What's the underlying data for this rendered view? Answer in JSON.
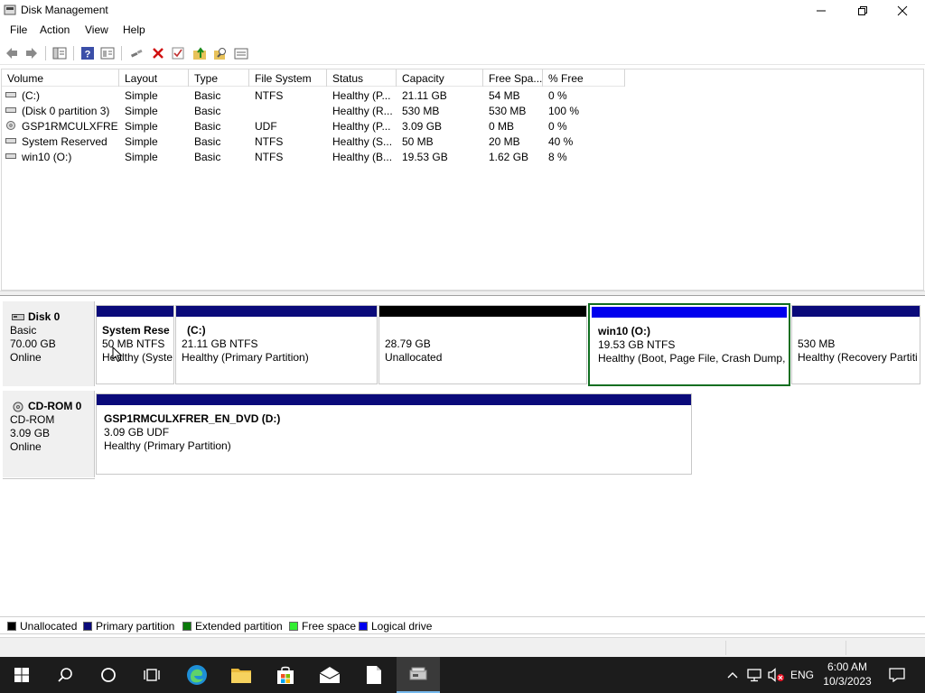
{
  "window": {
    "title": "Disk Management"
  },
  "menu": [
    "File",
    "Action",
    "View",
    "Help"
  ],
  "toolbar_icons": [
    "back-arrow-icon",
    "forward-arrow-icon",
    "console-tree-icon",
    "help-icon",
    "properties-icon",
    "connect-icon",
    "delete-icon",
    "check-icon",
    "folder-up-icon",
    "search-icon",
    "list-icon"
  ],
  "volume_list": {
    "columns": [
      "Volume",
      "Layout",
      "Type",
      "File System",
      "Status",
      "Capacity",
      "Free Spa...",
      "% Free"
    ],
    "rows": [
      [
        "(C:)",
        "Simple",
        "Basic",
        "NTFS",
        "Healthy (P...",
        "21.11 GB",
        "54 MB",
        "0 %"
      ],
      [
        "(Disk 0 partition 3)",
        "Simple",
        "Basic",
        "",
        "Healthy (R...",
        "530 MB",
        "530 MB",
        "100 %"
      ],
      [
        "GSP1RMCULXFRE...",
        "Simple",
        "Basic",
        "UDF",
        "Healthy (P...",
        "3.09 GB",
        "0 MB",
        "0 %"
      ],
      [
        "System Reserved",
        "Simple",
        "Basic",
        "NTFS",
        "Healthy (S...",
        "50 MB",
        "20 MB",
        "40 %"
      ],
      [
        "win10 (O:)",
        "Simple",
        "Basic",
        "NTFS",
        "Healthy (B...",
        "19.53 GB",
        "1.62 GB",
        "8 %"
      ]
    ]
  },
  "disks": [
    {
      "name": "Disk 0",
      "type": "Basic",
      "size": "70.00 GB",
      "state": "Online",
      "partitions": [
        {
          "name": "System Rese",
          "size": "50 MB NTFS",
          "status": "Healthy (Syste",
          "bar": "#0a0a7a"
        },
        {
          "name": "(C:)",
          "size": "21.11 GB NTFS",
          "status": "Healthy (Primary Partition)",
          "bar": "#0a0a7a"
        },
        {
          "name": "",
          "size": "28.79 GB",
          "status": "Unallocated",
          "bar": "#000000"
        },
        {
          "name": "win10  (O:)",
          "size": "19.53 GB NTFS",
          "status": "Healthy (Boot, Page File, Crash Dump,",
          "bar": "#0000ee"
        },
        {
          "name": "",
          "size": "530 MB",
          "status": "Healthy (Recovery Partiti",
          "bar": "#0a0a7a"
        }
      ]
    },
    {
      "name": "CD-ROM 0",
      "type": "CD-ROM",
      "size": "3.09 GB",
      "state": "Online",
      "partitions": [
        {
          "name": "GSP1RMCULXFRER_EN_DVD  (D:)",
          "size": "3.09 GB UDF",
          "status": "Healthy (Primary Partition)",
          "bar": "#0a0a7a"
        }
      ]
    }
  ],
  "legend": [
    {
      "label": "Unallocated",
      "color": "#000000"
    },
    {
      "label": "Primary partition",
      "color": "#0a0a7a"
    },
    {
      "label": "Extended partition",
      "color": "#0a7a0a"
    },
    {
      "label": "Free space",
      "color": "#33ee33"
    },
    {
      "label": "Logical drive",
      "color": "#0000ee"
    }
  ],
  "taskbar": {
    "language": "ENG",
    "time": "6:00 AM",
    "date": "10/3/2023"
  }
}
